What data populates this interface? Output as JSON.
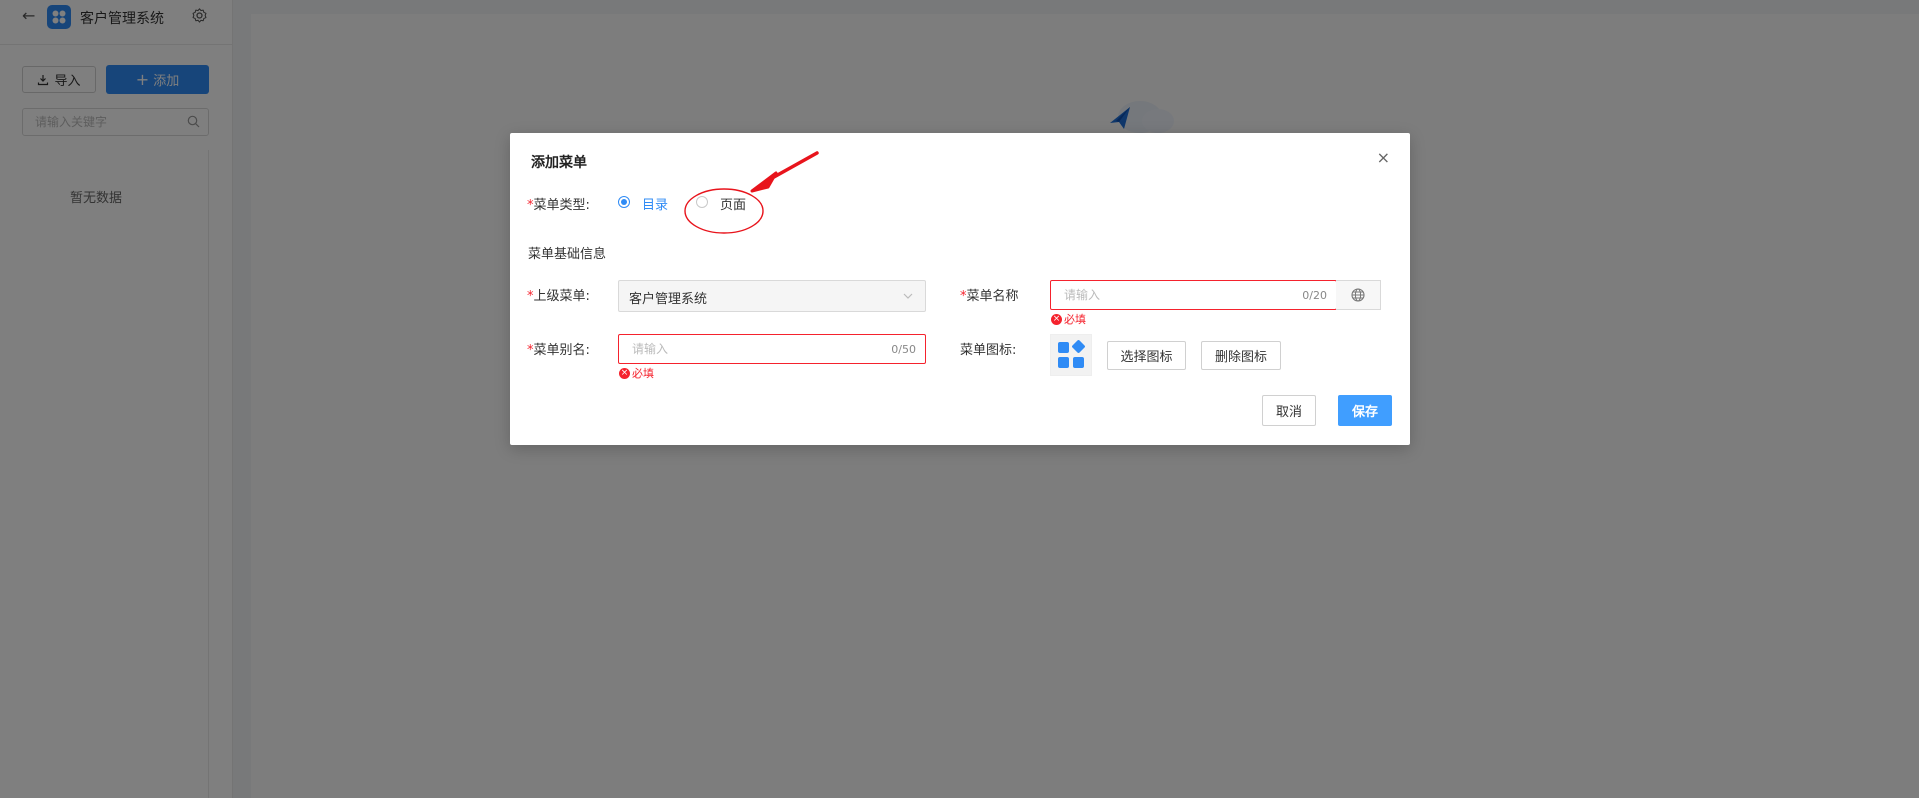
{
  "header": {
    "back_icon": "arrow-left-icon",
    "app_title": "客户管理系统",
    "settings_icon": "gear-icon"
  },
  "sidebar": {
    "import_label": "导入",
    "add_label": "添加",
    "search_placeholder": "请输入关键字",
    "empty_text": "暂无数据"
  },
  "dialog": {
    "title": "添加菜单",
    "menu_type": {
      "label": "菜单类型:",
      "options": [
        {
          "label": "目录",
          "selected": true
        },
        {
          "label": "页面",
          "selected": false
        }
      ]
    },
    "section_title": "菜单基础信息",
    "parent_menu": {
      "label": "上级菜单:",
      "value": "客户管理系统"
    },
    "menu_name": {
      "label": "菜单名称",
      "placeholder": "请输入",
      "count": "0/20",
      "error": "必填"
    },
    "menu_alias": {
      "label": "菜单别名:",
      "placeholder": "请输入",
      "count": "0/50",
      "error": "必填"
    },
    "menu_icon": {
      "label": "菜单图标:",
      "select_label": "选择图标",
      "delete_label": "删除图标"
    },
    "cancel_label": "取消",
    "save_label": "保存"
  },
  "colors": {
    "primary": "#2f8bf5",
    "error": "#f5222d",
    "annotation": "#e8141c"
  }
}
